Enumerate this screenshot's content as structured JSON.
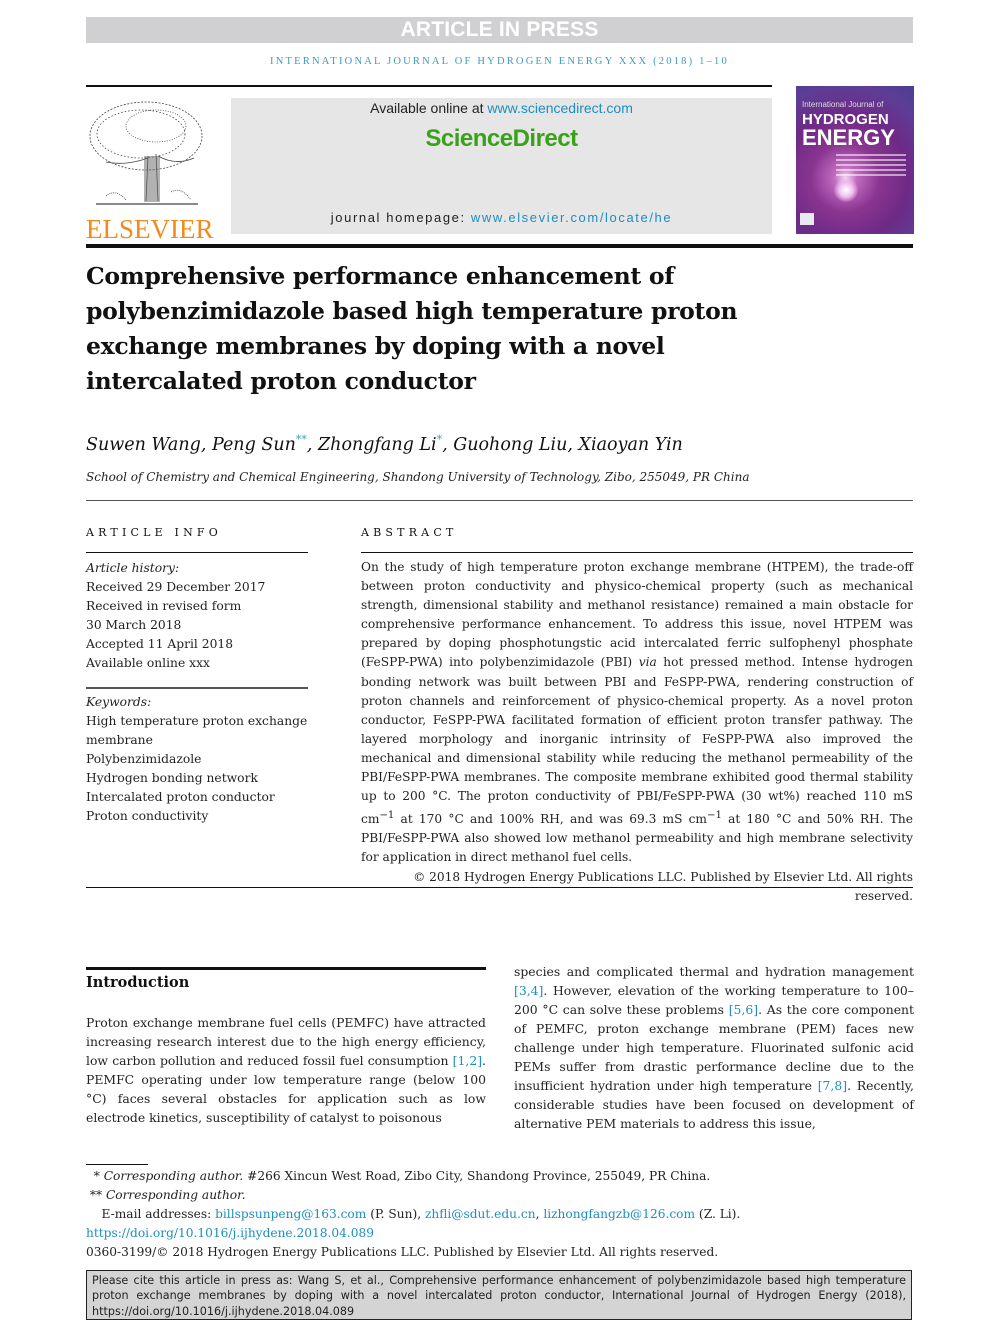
{
  "banner": {
    "text": "ARTICLE IN PRESS"
  },
  "journal_line": "International Journal of Hydrogen Energy xxx (2018) 1–10",
  "header": {
    "publisher_logo": "ELSEVIER",
    "available_prefix": "Available online at ",
    "available_link": "www.sciencedirect.com",
    "sciencedirect_logo": "ScienceDirect",
    "homepage_prefix": "journal homepage: ",
    "homepage_link": "www.elsevier.com/locate/he",
    "cover": {
      "small": "International Journal of",
      "line1": "HYDROGEN",
      "line2": "ENERGY"
    }
  },
  "title": "Comprehensive performance enhancement of polybenzimidazole based high temperature proton exchange membranes by doping with a novel intercalated proton conductor",
  "authors": [
    {
      "name": "Suwen Wang",
      "mark": ""
    },
    {
      "name": "Peng Sun",
      "mark": "**"
    },
    {
      "name": "Zhongfang Li",
      "mark": "*"
    },
    {
      "name": "Guohong Liu",
      "mark": ""
    },
    {
      "name": "Xiaoyan Yin",
      "mark": ""
    }
  ],
  "affiliation": "School of Chemistry and Chemical Engineering, Shandong University of Technology, Zibo, 255049, PR China",
  "article_info": {
    "heading": "ARTICLE INFO",
    "history_label": "Article history:",
    "history": [
      "Received 29 December 2017",
      "Received in revised form",
      "30 March 2018",
      "Accepted 11 April 2018",
      "Available online xxx"
    ],
    "keywords_label": "Keywords:",
    "keywords": [
      "High temperature proton exchange",
      "membrane",
      "Polybenzimidazole",
      "Hydrogen bonding network",
      "Intercalated proton conductor",
      "Proton conductivity"
    ]
  },
  "abstract": {
    "heading": "ABSTRACT",
    "text_a": "On the study of high temperature proton exchange membrane (HTPEM), the trade-off between proton conductivity and physico-chemical property (such as mechanical strength, dimensional stability and methanol resistance) remained a main obstacle for comprehensive performance enhancement. To address this issue, novel HTPEM was prepared by doping phosphotungstic acid intercalated ferric sulfophenyl phosphate (FeSPP-PWA) into polybenzimidazole (PBI) ",
    "text_via": "via",
    "text_b": " hot pressed method. Intense hydrogen bonding network was built between PBI and FeSPP-PWA, rendering construction of proton channels and reinforcement of physico-chemical property. As a novel proton conductor, FeSPP-PWA facilitated formation of efficient proton transfer pathway. The layered morphology and inorganic intrinsity of FeSPP-PWA also improved the mechanical and dimensional stability while reducing the methanol permeability of the PBI/FeSPP-PWA membranes. The composite membrane exhibited good thermal stability up to 200 °C. The proton conductivity of PBI/FeSPP-PWA (30 wt%) reached 110 mS cm",
    "sup1": "−1",
    "text_c": " at 170 °C and 100% RH, and was 69.3 mS cm",
    "sup2": "−1",
    "text_d": " at 180 °C and 50% RH. The PBI/FeSPP-PWA also showed low methanol permeability and high membrane selectivity for application in direct methanol fuel cells.",
    "copyright": "© 2018 Hydrogen Energy Publications LLC. Published by Elsevier Ltd. All rights reserved."
  },
  "introduction": {
    "heading": "Introduction",
    "col1_a": "Proton exchange membrane fuel cells (PEMFC) have attracted increasing research interest due to the high energy efficiency, low carbon pollution and reduced fossil fuel consumption ",
    "ref1": "[1,2]",
    "col1_b": ". PEMFC operating under low temperature range (below 100 °C) faces several obstacles for application such as low electrode kinetics, susceptibility of catalyst to poisonous",
    "col2_a": "species and complicated thermal and hydration management ",
    "ref2": "[3,4]",
    "col2_b": ". However, elevation of the working temperature to 100–200 °C can solve these problems ",
    "ref3": "[5,6]",
    "col2_c": ". As the core component of PEMFC, proton exchange membrane (PEM) faces new challenge under high temperature. Fluorinated sulfonic acid PEMs suffer from drastic performance decline due to the insufficient hydration under high temperature ",
    "ref4": "[7,8]",
    "col2_d": ". Recently, considerable studies have been focused on development of alternative PEM materials to address this issue,"
  },
  "footnotes": {
    "fn1_mark": "* ",
    "fn1_label": "Corresponding author.",
    "fn1_text": " #266 Xincun West Road, Zibo City, Shandong Province, 255049, PR China.",
    "fn2_mark": "** ",
    "fn2_label": "Corresponding author.",
    "email_label": "E-mail addresses: ",
    "email1": "billspsunpeng@163.com",
    "email1_who": " (P. Sun), ",
    "email2": "zhfli@sdut.edu.cn",
    "sep": ", ",
    "email3": "lizhongfangzb@126.com",
    "email3_who": " (Z. Li).",
    "doi": "https://doi.org/10.1016/j.ijhydene.2018.04.089",
    "issn_line": "0360-3199/© 2018 Hydrogen Energy Publications LLC. Published by Elsevier Ltd. All rights reserved."
  },
  "cite_box": "Please cite this article in press as: Wang S, et al., Comprehensive performance enhancement of polybenzimidazole based high temperature proton exchange membranes by doping with a novel intercalated proton conductor, International Journal of Hydrogen Energy (2018), https://doi.org/10.1016/j.ijhydene.2018.04.089"
}
